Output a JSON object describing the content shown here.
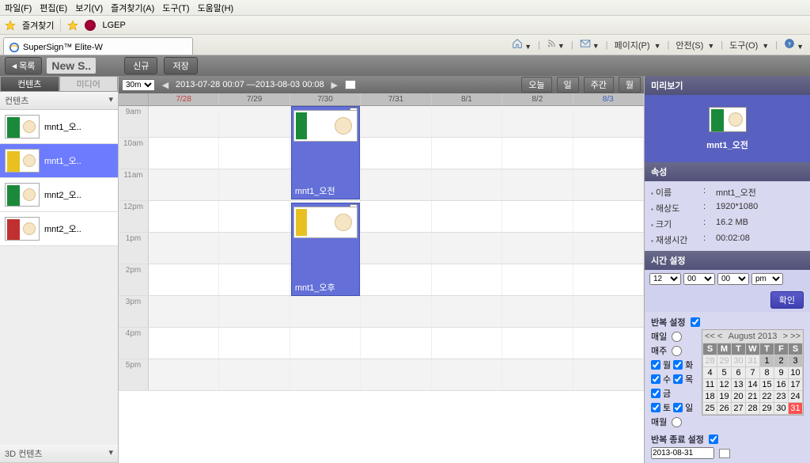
{
  "menu": {
    "file": "파일(F)",
    "edit": "편집(E)",
    "view": "보기(V)",
    "fav": "즐겨찾기(A)",
    "tool": "도구(T)",
    "help": "도움말(H)"
  },
  "bookmarks": {
    "fav": "즐겨찾기",
    "lgep": "LGEP"
  },
  "tab": {
    "title": "SuperSign™ Elite-W"
  },
  "ie_tools": {
    "page": "페이지(P)",
    "safety": "안전(S)",
    "tools": "도구(O)"
  },
  "appbar": {
    "list": "목록",
    "title": "New S..",
    "new": "신규",
    "save": "저장"
  },
  "left": {
    "tab_content": "컨텐츠",
    "tab_media": "미디어",
    "section": "컨텐츠",
    "section3d": "3D 컨텐츠",
    "items": [
      {
        "name": "mnt1_오..",
        "color": "green"
      },
      {
        "name": "mnt1_오..",
        "color": "yellow"
      },
      {
        "name": "mnt2_오..",
        "color": "green2"
      },
      {
        "name": "mnt2_오..",
        "color": "red"
      }
    ]
  },
  "calendar": {
    "zoom": "30m",
    "range": "2013-07-28 00:07 —2013-08-03 00:08",
    "today": "오늘",
    "day": "일",
    "week": "주간",
    "month": "월",
    "days": [
      "7/28",
      "7/29",
      "7/30",
      "7/31",
      "8/1",
      "8/2",
      "8/3"
    ],
    "hours": [
      "9am",
      "10am",
      "11am",
      "12pm",
      "1pm",
      "2pm",
      "3pm",
      "4pm",
      "5pm"
    ],
    "events": [
      {
        "title": "mnt1_오전",
        "color": "green"
      },
      {
        "title": "mnt1_오후",
        "color": "yellow"
      }
    ]
  },
  "right": {
    "preview": "미리보기",
    "preview_name": "mnt1_오전",
    "props_header": "속성",
    "props": {
      "name_k": "이름",
      "name_v": "mnt1_오전",
      "res_k": "해상도",
      "res_v": "1920*1080",
      "size_k": "크기",
      "size_v": "16.2 MB",
      "play_k": "재생시간",
      "play_v": "00:02:08"
    },
    "time_header": "시간 설정",
    "hour": "12",
    "min": "00",
    "sec": "00",
    "ampm": "pm",
    "confirm": "확인",
    "repeat_header": "반복 설정",
    "daily": "매일",
    "weekly": "매주",
    "monthly": "매월",
    "dow": {
      "mon": "월",
      "tue": "화",
      "wed": "수",
      "thu": "목",
      "fri": "금",
      "sat": "토",
      "sun": "일"
    },
    "end_header": "반복 종료 설정",
    "end_date": "2013-08-31",
    "cal": {
      "title": "August 2013",
      "dh": [
        "S",
        "M",
        "T",
        "W",
        "T",
        "F",
        "S"
      ],
      "rows": [
        [
          "28",
          "29",
          "30",
          "31",
          "1",
          "2",
          "3"
        ],
        [
          "4",
          "5",
          "6",
          "7",
          "8",
          "9",
          "10"
        ],
        [
          "11",
          "12",
          "13",
          "14",
          "15",
          "16",
          "17"
        ],
        [
          "18",
          "19",
          "20",
          "21",
          "22",
          "23",
          "24"
        ],
        [
          "25",
          "26",
          "27",
          "28",
          "29",
          "30",
          "31"
        ]
      ]
    }
  }
}
